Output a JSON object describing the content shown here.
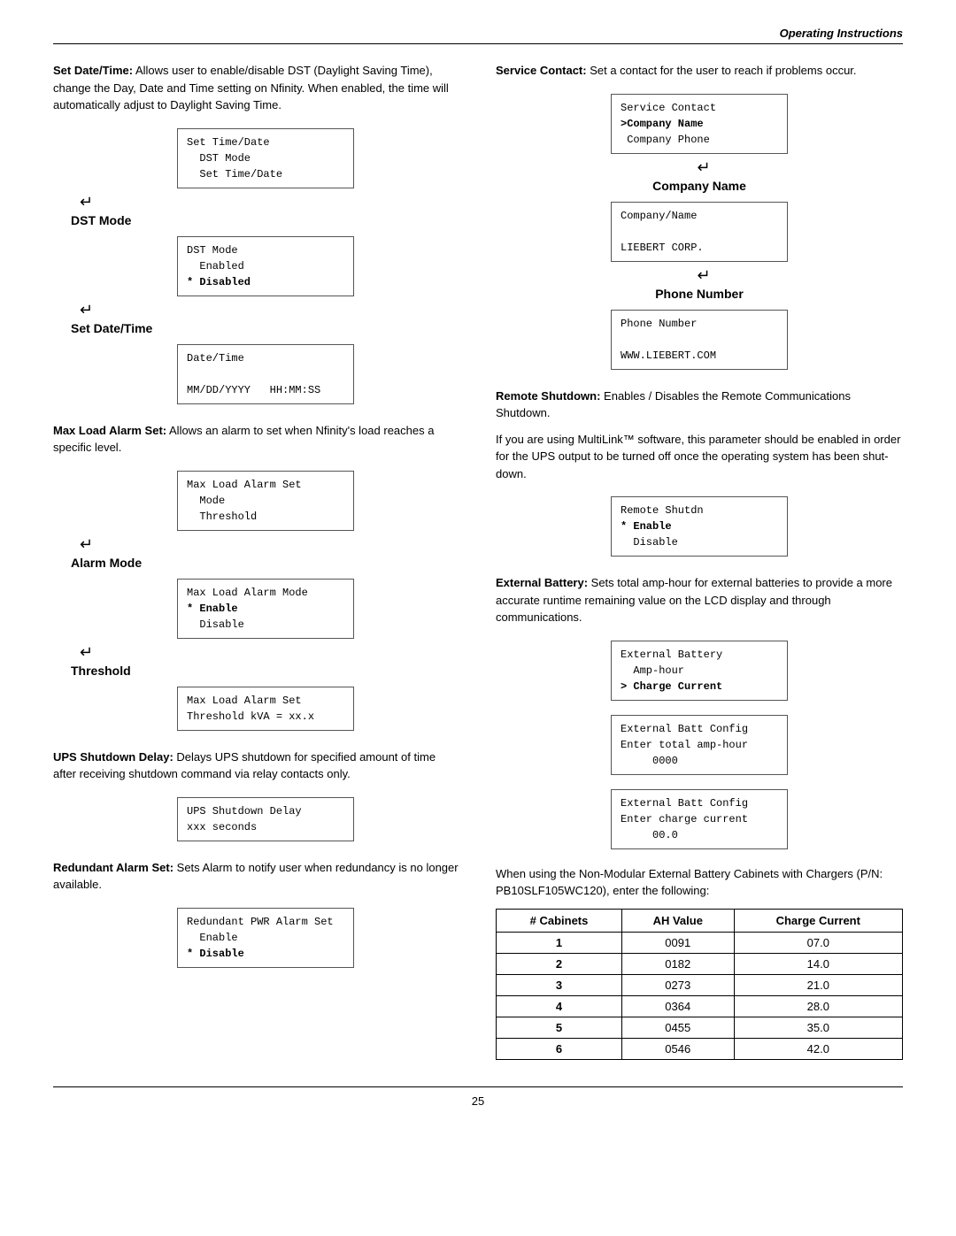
{
  "header": {
    "title": "Operating Instructions"
  },
  "left_col": {
    "set_date_time": {
      "intro": "Set Date/Time: Allows user to enable/disable DST (Daylight Saving Time), change the Day, Date and Time setting on Nfinity. When enabled, the time will automatically adjust to Daylight Saving Time.",
      "box1_lines": [
        "Set Time/Date",
        "  DST Mode",
        "  Set Time/Date"
      ],
      "dst_mode_label": "DST Mode",
      "box2_lines": [
        "DST Mode",
        "  Enabled",
        "* Disabled"
      ],
      "set_date_label": "Set Date/Time",
      "box3_lines": [
        "Date/Time",
        "",
        "MM/DD/YYYY   HH:MM:SS"
      ]
    },
    "max_load": {
      "intro": "Max Load Alarm Set: Allows an alarm to set when Nfinity's load reaches a specific level.",
      "box1_lines": [
        "Max Load Alarm Set",
        "  Mode",
        "  Threshold"
      ],
      "alarm_mode_label": "Alarm Mode",
      "box2_lines": [
        "Max Load Alarm Mode",
        "* Enable",
        "  Disable"
      ],
      "threshold_label": "Threshold",
      "box3_lines": [
        "Max Load Alarm Set",
        "Threshold kVA = xx.x"
      ]
    },
    "ups_shutdown": {
      "intro": "UPS Shutdown Delay: Delays UPS shutdown for specified amount of time after receiving shutdown command via relay contacts only.",
      "box_lines": [
        "UPS Shutdown Delay",
        "xxx seconds"
      ]
    },
    "redundant": {
      "intro": "Redundant Alarm Set: Sets Alarm to notify user when redundancy is no longer available.",
      "box_lines": [
        "Redundant PWR Alarm Set",
        "  Enable",
        "* Disable"
      ]
    }
  },
  "right_col": {
    "service_contact": {
      "intro": "Service Contact: Set a contact for the user to reach if problems occur.",
      "box1_lines": [
        "Service Contact",
        ">Company Name",
        " Company Phone"
      ],
      "company_name_label": "Company Name",
      "box2_lines": [
        "Company/Name",
        "",
        "LIEBERT CORP."
      ],
      "phone_number_label": "Phone Number",
      "box3_lines": [
        "Phone Number",
        "",
        "WWW.LIEBERT.COM"
      ]
    },
    "remote_shutdown": {
      "intro1": "Remote Shutdown: Enables / Disables the Remote Communications Shutdown.",
      "intro2": "If you are using MultiLink™ software, this parameter should be enabled in order for the UPS output to be turned off once the operating system has been shut-down.",
      "box_lines": [
        "Remote Shutdn",
        "* Enable",
        "  Disable"
      ]
    },
    "external_battery": {
      "intro": "External Battery: Sets total amp-hour for external batteries to provide a more accurate runtime remaining value on the LCD display and through communications.",
      "box1_lines": [
        "External Battery",
        "  Amp-hour",
        "> Charge Current"
      ],
      "box2_lines": [
        "External Batt Config",
        "Enter total amp-hour",
        "     0000"
      ],
      "box3_lines": [
        "External Batt Config",
        "Enter charge current",
        "     00.0"
      ],
      "outro": "When using the Non-Modular External Battery Cabinets with Chargers (P/N: PB10SLF105WC120), enter the following:",
      "table": {
        "headers": [
          "# Cabinets",
          "AH Value",
          "Charge Current"
        ],
        "rows": [
          [
            "1",
            "0091",
            "07.0"
          ],
          [
            "2",
            "0182",
            "14.0"
          ],
          [
            "3",
            "0273",
            "21.0"
          ],
          [
            "4",
            "0364",
            "28.0"
          ],
          [
            "5",
            "0455",
            "35.0"
          ],
          [
            "6",
            "0546",
            "42.0"
          ]
        ]
      }
    }
  },
  "footer": {
    "page_number": "25"
  }
}
